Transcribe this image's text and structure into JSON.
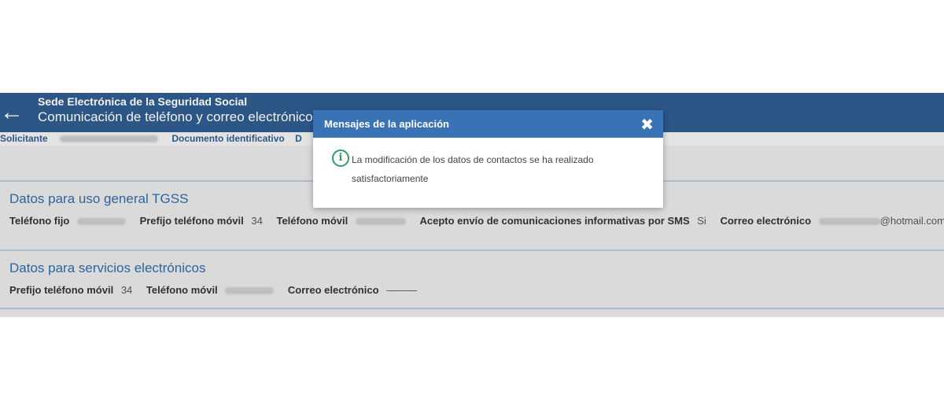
{
  "header": {
    "back_icon": "←",
    "app_title": "Sede Electrónica de la Seguridad Social",
    "page_title": "Comunicación de teléfono y correo electrónico"
  },
  "infobar": {
    "solicitante_label": "Solicitante",
    "documento_label": "Documento identificativo",
    "truncated_label": "D"
  },
  "section_general": {
    "title": "Datos para uso general TGSS",
    "telefono_fijo_label": "Teléfono fijo",
    "prefijo_label": "Prefijo teléfono móvil",
    "prefijo_value": "34",
    "telefono_movil_label": "Teléfono móvil",
    "sms_label": "Acepto envío de comunicaciones informativas por SMS",
    "sms_value": "Si",
    "correo_label": "Correo electrónico",
    "correo_domain": "@hotmail.com"
  },
  "section_electronicos": {
    "title": "Datos para servicios electrónicos",
    "prefijo_label": "Prefijo teléfono móvil",
    "prefijo_value": "34",
    "telefono_movil_label": "Teléfono móvil",
    "correo_label": "Correo electrónico",
    "correo_value": "———"
  },
  "modal": {
    "title": "Mensajes de la aplicación",
    "close_icon": "✖",
    "info_icon": "i",
    "message": "La modificación de los datos de contactos se ha realizado satisfactoriamente"
  },
  "colors": {
    "header": "#2e5b8e",
    "modal_header": "#3a73b5",
    "section_title": "#2e6aa8",
    "info_icon": "#2f9a6a"
  }
}
